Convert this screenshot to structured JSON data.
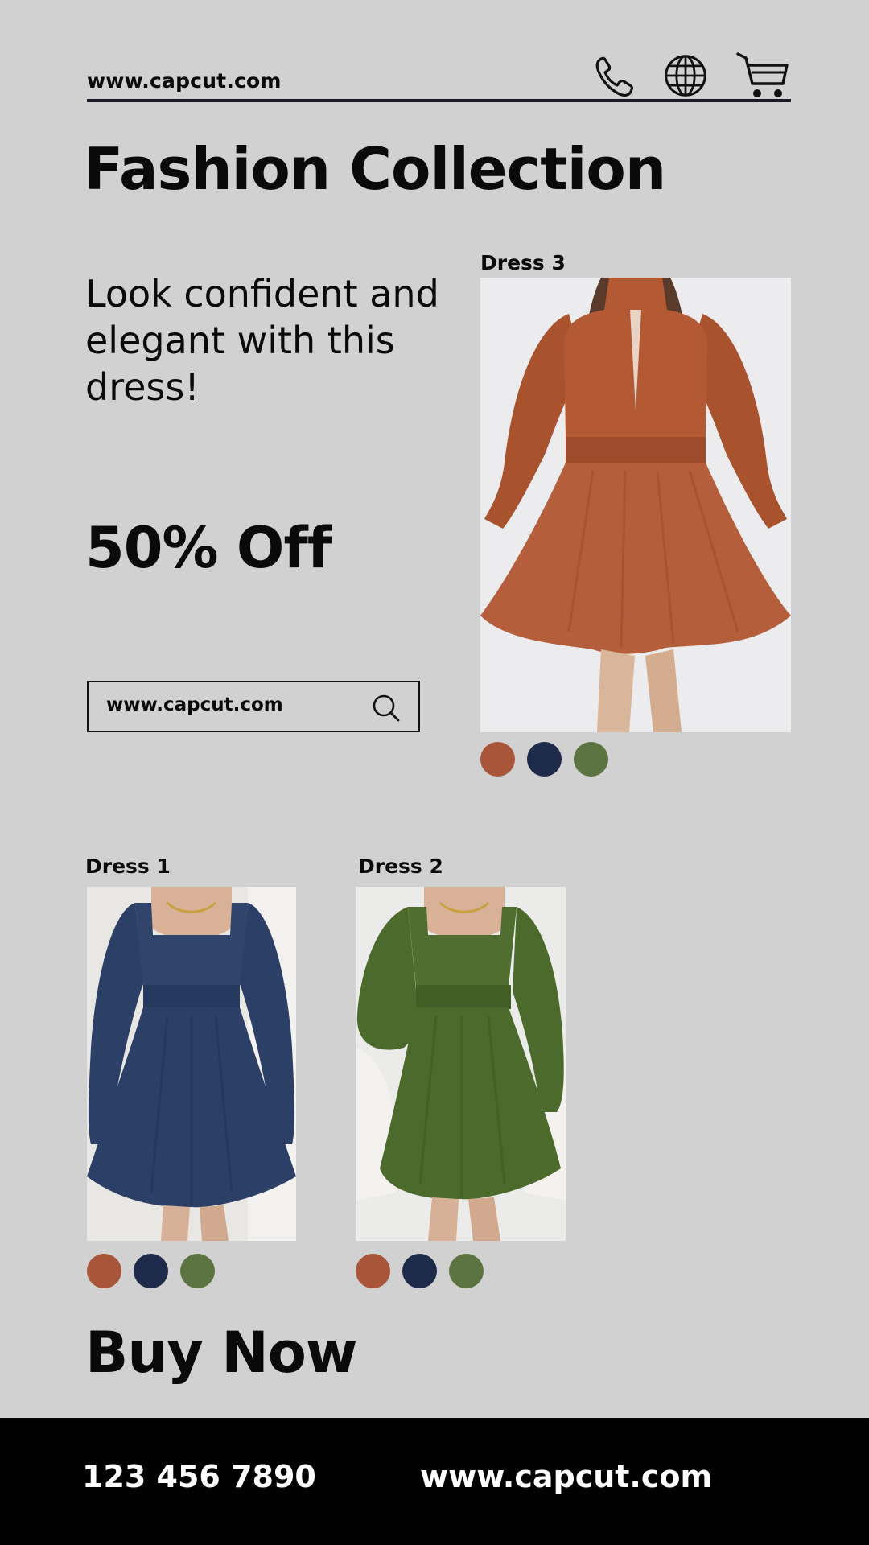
{
  "header": {
    "site_url": "www.capcut.com",
    "icons": [
      "phone-icon",
      "globe-icon",
      "cart-icon"
    ]
  },
  "title": "Fashion Collection",
  "tagline": "Look confident and elegant with this dress!",
  "discount": "50% Off",
  "search": {
    "value": "www.capcut.com",
    "icon": "search-icon"
  },
  "products": [
    {
      "label": "Dress 3",
      "color": "#b55e3b",
      "swatches": [
        "#a8553a",
        "#1e2a4a",
        "#5c7441"
      ]
    },
    {
      "label": "Dress 1",
      "color": "#2c3f66",
      "swatches": [
        "#a8553a",
        "#1e2a4a",
        "#5c7441"
      ]
    },
    {
      "label": "Dress 2",
      "color": "#4b6a2c",
      "swatches": [
        "#a8553a",
        "#1e2a4a",
        "#5c7441"
      ]
    }
  ],
  "cta": "Buy Now",
  "footer": {
    "phone": "123 456 7890",
    "url": "www.capcut.com"
  }
}
